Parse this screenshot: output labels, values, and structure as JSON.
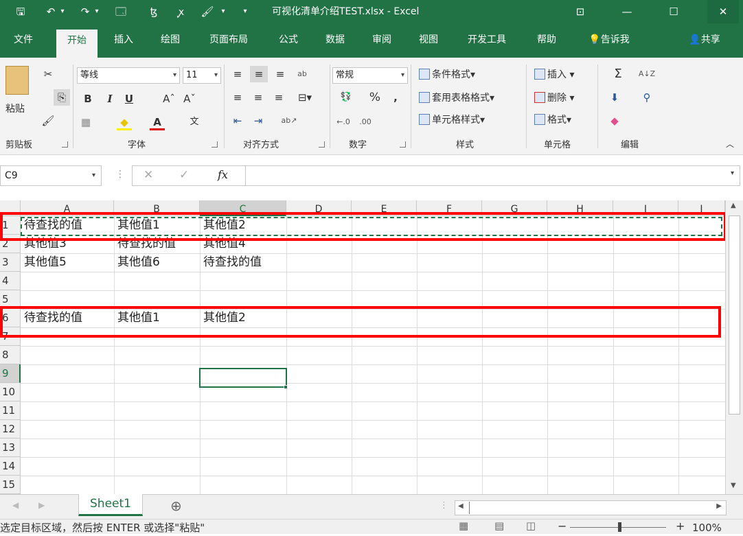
{
  "window": {
    "title": "可视化清单介绍TEST.xlsx  -  Excel",
    "controls": {
      "ribbon_display": "⊡",
      "minimize": "—",
      "maximize": "☐",
      "close": "✕"
    }
  },
  "quick_access": {
    "save": "🖫",
    "undo": "↶",
    "undo_drop": "▾",
    "redo": "↷",
    "redo_drop": "▾",
    "form": "🗔",
    "sort": "ꜩ",
    "spell": "ꭙ",
    "brush": "🖌",
    "more": "▾",
    "customize": "▾"
  },
  "tabs": [
    {
      "label": "文件"
    },
    {
      "label": "开始"
    },
    {
      "label": "插入"
    },
    {
      "label": "绘图"
    },
    {
      "label": "页面布局"
    },
    {
      "label": "公式"
    },
    {
      "label": "数据"
    },
    {
      "label": "审阅"
    },
    {
      "label": "视图"
    },
    {
      "label": "开发工具"
    },
    {
      "label": "帮助"
    },
    {
      "label": "告诉我"
    }
  ],
  "share": "共享",
  "ribbon": {
    "clipboard": {
      "paste": "粘贴",
      "group": "剪贴板",
      "cut_icon": "✂",
      "copy_icon": "⎘",
      "format_painter_icon": "🖌"
    },
    "font": {
      "name": "等线",
      "size": "11",
      "group": "字体",
      "bold": "B",
      "italic": "I",
      "underline": "U",
      "grow": "Aˆ",
      "shrink": "Aˇ",
      "border": "▦",
      "fill": "◆",
      "color": "A",
      "phonetic": "文"
    },
    "alignment": {
      "group": "对齐方式",
      "wrap": "ab",
      "orient": "ab↗"
    },
    "number": {
      "format": "常规",
      "group": "数字",
      "currency": "💱",
      "percent": "%",
      "comma": ","
    },
    "styles": {
      "conditional": "条件格式",
      "table": "套用表格格式",
      "cell": "单元格样式",
      "group": "样式"
    },
    "cells": {
      "insert": "插入",
      "delete": "删除",
      "format": "格式",
      "group": "单元格"
    },
    "editing": {
      "group": "编辑",
      "sum": "Σ",
      "sort": "A↓Z",
      "fill": "⬇",
      "find": "⚲",
      "clear": "◆"
    }
  },
  "formula_bar": {
    "name_box": "C9",
    "cancel": "✕",
    "enter": "✓",
    "fx": "fx",
    "value": ""
  },
  "columns": [
    "A",
    "B",
    "C",
    "D",
    "E",
    "F",
    "G",
    "H",
    "I",
    "J"
  ],
  "rows": [
    "1",
    "2",
    "3",
    "4",
    "5",
    "6",
    "7",
    "8",
    "9",
    "10",
    "11",
    "12",
    "13",
    "14",
    "15"
  ],
  "cells": {
    "A1": "待查找的值",
    "B1": "其他值1",
    "C1": "其他值2",
    "A2": "其他值3",
    "B2": "待查找的值",
    "C2": "其他值4",
    "A3": "其他值5",
    "B3": "其他值6",
    "C3": "待查找的值",
    "A6": "待查找的值",
    "B6": "其他值1",
    "C6": "其他值2"
  },
  "sheets": [
    {
      "name": "Sheet1"
    }
  ],
  "add_sheet": "⊕",
  "status": {
    "message": "选定目标区域，然后按 ENTER 或选择\"粘贴\"",
    "zoom": "100%",
    "zoom_minus": "−",
    "zoom_plus": "+"
  },
  "colors": {
    "accent": "#217346",
    "highlight": "#ff0000"
  }
}
